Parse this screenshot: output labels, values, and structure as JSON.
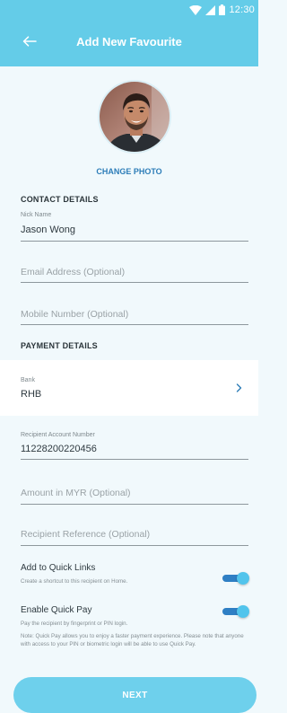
{
  "status_bar": {
    "time": "12:30",
    "icons": [
      "wifi-icon",
      "signal-icon",
      "battery-icon"
    ],
    "background": "#64cce8"
  },
  "header": {
    "title": "Add New Favourite",
    "back_icon": "arrow-left-icon",
    "background": "#64cce8"
  },
  "photo": {
    "change_label": "CHANGE PHOTO",
    "avatar": "profile-photo"
  },
  "contact_details": {
    "heading": "CONTACT DETAILS",
    "nick_name": {
      "label": "Nick Name",
      "value": "Jason Wong"
    },
    "email": {
      "placeholder": "Email Address (Optional)"
    },
    "mobile": {
      "placeholder": "Mobile Number (Optional)"
    }
  },
  "payment_details": {
    "heading": "PAYMENT DETAILS",
    "bank": {
      "label": "Bank",
      "value": "RHB",
      "icon": "chevron-right-icon"
    },
    "account": {
      "label": "Recipient Account Number",
      "value": "11228200220456"
    },
    "amount": {
      "placeholder": "Amount in MYR (Optional)"
    },
    "reference": {
      "placeholder": "Recipient Reference (Optional)"
    }
  },
  "quick_links": {
    "title": "Add to Quick Links",
    "description": "Create a shortcut to this recipient on Home.",
    "enabled": true
  },
  "quick_pay": {
    "title": "Enable Quick Pay",
    "description": "Pay the recipient by fingerprint or PIN login.",
    "note": "Note: Quick Pay allows you to enjoy a faster payment experience. Please note that anyone with access to your PIN or biometric login will be able to use Quick Pay.",
    "enabled": true
  },
  "footer": {
    "next_label": "NEXT"
  },
  "colors": {
    "accent": "#64cce8",
    "link": "#2d7db8",
    "toggle_track": "#2f7fc4",
    "toggle_knob": "#51c4ec",
    "page_background": "#f1f9fc"
  }
}
